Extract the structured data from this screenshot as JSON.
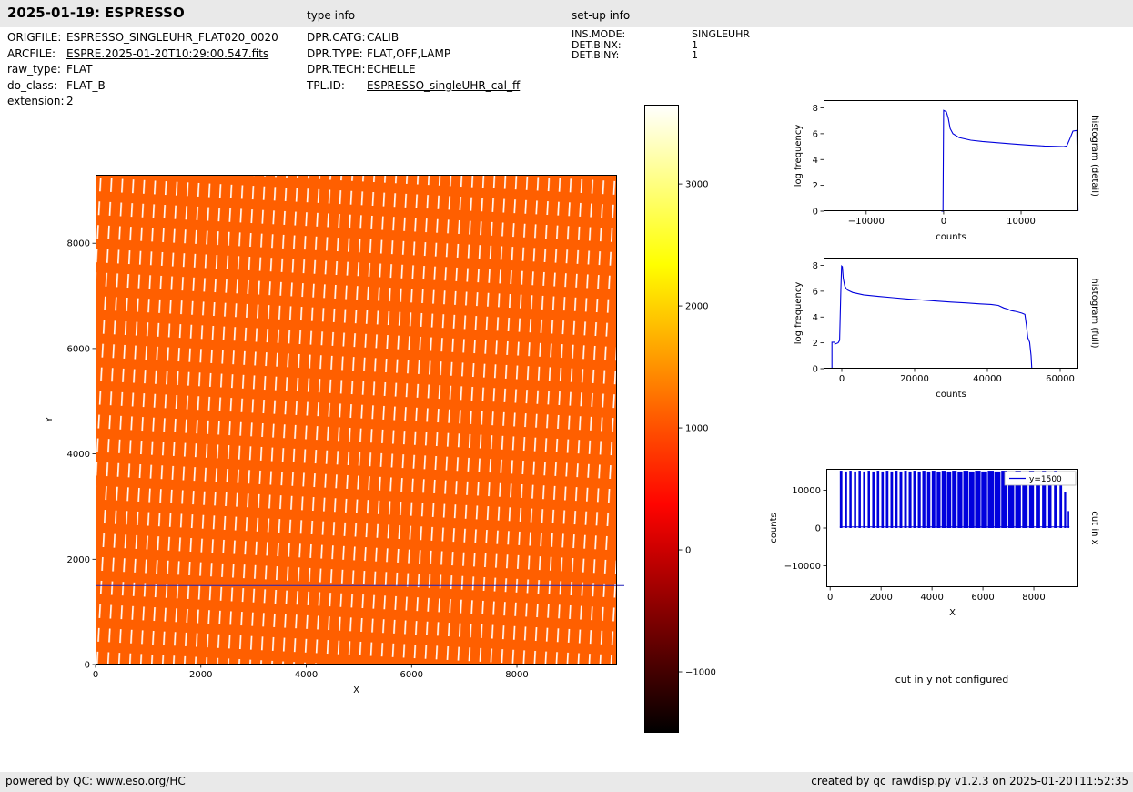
{
  "header": {
    "title": "2025-01-19: ESPRESSO",
    "type_info_label": "type info",
    "setup_info_label": "set-up info"
  },
  "file_info": {
    "rows": [
      {
        "label": "ORIGFILE:",
        "value": "ESPRESSO_SINGLEUHR_FLAT020_0020"
      },
      {
        "label": "ARCFILE:",
        "value": "ESPRE.2025-01-20T10:29:00.547.fits"
      },
      {
        "label": "raw_type:",
        "value": "FLAT"
      },
      {
        "label": "do_class:",
        "value": "FLAT_B"
      },
      {
        "label": "extension:",
        "value": "2"
      }
    ]
  },
  "type_info": {
    "rows": [
      {
        "label": "DPR.CATG:",
        "value": "CALIB"
      },
      {
        "label": "DPR.TYPE:",
        "value": "FLAT,OFF,LAMP"
      },
      {
        "label": "DPR.TECH:",
        "value": "ECHELLE"
      },
      {
        "label": "TPL.ID:",
        "value": "ESPRESSO_singleUHR_cal_ff"
      }
    ]
  },
  "setup_info": {
    "rows": [
      {
        "label": "INS.MODE:",
        "value": "SINGLEUHR"
      },
      {
        "label": "DET.BINX:",
        "value": "1"
      },
      {
        "label": "DET.BINY:",
        "value": "1"
      }
    ]
  },
  "notes": {
    "cut_y": "cut in y not configured"
  },
  "footer": {
    "left": "powered by QC: www.eso.org/HC",
    "right": "created by qc_rawdisp.py v1.2.3 on 2025-01-20T11:52:35"
  },
  "chart_data": {
    "main_image": {
      "type": "heatmap",
      "description": "Raw ESPRESSO echelle flat-field frame: uniform ~1000-count orange background crossed by near-vertical dashed white echelle orders; blue horizontal cut line at y=1500",
      "xlabel": "X",
      "ylabel": "Y",
      "xlim": [
        0,
        9900
      ],
      "ylim": [
        0,
        9300
      ],
      "xticks": [
        [
          0,
          "0"
        ],
        [
          2000,
          "2000"
        ],
        [
          4000,
          "4000"
        ],
        [
          6000,
          "6000"
        ],
        [
          8000,
          "8000"
        ]
      ],
      "yticks": [
        [
          0,
          "0"
        ],
        [
          2000,
          "2000"
        ],
        [
          4000,
          "4000"
        ],
        [
          6000,
          "6000"
        ],
        [
          8000,
          "8000"
        ]
      ],
      "base_color": "#ff5f00",
      "stripe_color": "#ffffff",
      "ylabel_off": 48,
      "hline": {
        "y": 1500,
        "color": "#2222bb",
        "label": "y=1500"
      }
    },
    "colorbar": {
      "type": "colorbar",
      "description": "hot colormap, counts scale",
      "vmin": -1500,
      "vmax": 3650,
      "ticks": [
        [
          3000,
          "3000"
        ],
        [
          2000,
          "2000"
        ],
        [
          1000,
          "1000"
        ],
        [
          0,
          "0"
        ],
        [
          -1000,
          "−1000"
        ]
      ],
      "stops": [
        [
          "0%",
          "#000000"
        ],
        [
          "14.6%",
          "#660000"
        ],
        [
          "29.1%",
          "#cc0000"
        ],
        [
          "36.4%",
          "#ff0400"
        ],
        [
          "48.5%",
          "#ff5000"
        ],
        [
          "58.3%",
          "#ff9200"
        ],
        [
          "68%",
          "#ffd300"
        ],
        [
          "74.6%",
          "#ffff00"
        ],
        [
          "87.4%",
          "#ffff80"
        ],
        [
          "100%",
          "#ffffff"
        ]
      ]
    },
    "hist_detail": {
      "type": "line",
      "xlabel": "counts",
      "ylabel": "log frequency",
      "right_label": "histogram (detail)",
      "xlim": [
        -15500,
        17400
      ],
      "ylim": [
        0,
        8.6
      ],
      "xticks": [
        [
          -10000,
          "−10000"
        ],
        [
          0,
          "0"
        ],
        [
          10000,
          "10000"
        ]
      ],
      "yticks": [
        [
          0,
          "0"
        ],
        [
          2,
          "2"
        ],
        [
          4,
          "4"
        ],
        [
          6,
          "6"
        ],
        [
          8,
          "8"
        ]
      ],
      "ylabel_off": 25,
      "series": [
        {
          "name": "log frequency",
          "color": "#0000dd",
          "points": [
            [
              -300,
              0
            ],
            [
              -80,
              0
            ],
            [
              0,
              7.8
            ],
            [
              350,
              7.7
            ],
            [
              600,
              7.2
            ],
            [
              850,
              6.4
            ],
            [
              1200,
              6.0
            ],
            [
              2000,
              5.7
            ],
            [
              3500,
              5.5
            ],
            [
              5000,
              5.4
            ],
            [
              7000,
              5.3
            ],
            [
              9000,
              5.2
            ],
            [
              11000,
              5.12
            ],
            [
              13000,
              5.05
            ],
            [
              15500,
              5.0
            ],
            [
              15900,
              5.05
            ],
            [
              16300,
              5.6
            ],
            [
              16700,
              6.2
            ],
            [
              17200,
              6.25
            ],
            [
              17350,
              0
            ]
          ]
        }
      ]
    },
    "hist_full": {
      "type": "line",
      "xlabel": "counts",
      "ylabel": "log frequency",
      "right_label": "histogram (full)",
      "xlim": [
        -5000,
        65000
      ],
      "ylim": [
        0,
        8.6
      ],
      "xticks": [
        [
          0,
          "0"
        ],
        [
          20000,
          "20000"
        ],
        [
          40000,
          "40000"
        ],
        [
          60000,
          "60000"
        ]
      ],
      "yticks": [
        [
          0,
          "0"
        ],
        [
          2,
          "2"
        ],
        [
          4,
          "4"
        ],
        [
          6,
          "6"
        ],
        [
          8,
          "8"
        ]
      ],
      "ylabel_off": 25,
      "series": [
        {
          "name": "log frequency",
          "color": "#0000dd",
          "points": [
            [
              -2700,
              0
            ],
            [
              -2700,
              2.05
            ],
            [
              -1900,
              2.05
            ],
            [
              -1900,
              1.9
            ],
            [
              -1000,
              2.0
            ],
            [
              -600,
              2.2
            ],
            [
              -250,
              6.2
            ],
            [
              -50,
              7.95
            ],
            [
              150,
              7.9
            ],
            [
              400,
              7.0
            ],
            [
              800,
              6.4
            ],
            [
              1500,
              6.1
            ],
            [
              3000,
              5.9
            ],
            [
              6000,
              5.72
            ],
            [
              10000,
              5.6
            ],
            [
              14000,
              5.5
            ],
            [
              18000,
              5.4
            ],
            [
              22000,
              5.32
            ],
            [
              26000,
              5.24
            ],
            [
              30000,
              5.16
            ],
            [
              34000,
              5.1
            ],
            [
              38000,
              5.02
            ],
            [
              41000,
              4.98
            ],
            [
              43000,
              4.9
            ],
            [
              44500,
              4.7
            ],
            [
              45500,
              4.62
            ],
            [
              46500,
              4.5
            ],
            [
              47500,
              4.45
            ],
            [
              48500,
              4.38
            ],
            [
              49500,
              4.3
            ],
            [
              50300,
              4.2
            ],
            [
              50700,
              3.4
            ],
            [
              51100,
              2.4
            ],
            [
              51600,
              2.05
            ],
            [
              52000,
              1.0
            ],
            [
              52200,
              0
            ]
          ]
        }
      ]
    },
    "cut_x": {
      "type": "bars",
      "description": "Cut through the raw frame at row y=1500: echelle orders appear as dense vertical spikes up to ~15000 counts",
      "xlabel": "X",
      "ylabel": "counts",
      "right_label": "cut in x",
      "xlim": [
        -150,
        9750
      ],
      "ylim": [
        -15700,
        15700
      ],
      "xticks": [
        [
          0,
          "0"
        ],
        [
          2000,
          "2000"
        ],
        [
          4000,
          "4000"
        ],
        [
          6000,
          "6000"
        ],
        [
          8000,
          "8000"
        ]
      ],
      "yticks": [
        [
          -10000,
          "−10000"
        ],
        [
          0,
          "0"
        ],
        [
          10000,
          "10000"
        ]
      ],
      "ylabel_off": 55,
      "bar_color": "#0000dd",
      "baseline": [
        380,
        9400,
        300
      ],
      "legend": {
        "label": "y=1500",
        "color": "#0000dd"
      },
      "bars": [
        [
          430,
          100,
          15200
        ],
        [
          620,
          90,
          15000
        ],
        [
          800,
          90,
          15200
        ],
        [
          980,
          90,
          15000
        ],
        [
          1160,
          90,
          15200
        ],
        [
          1340,
          90,
          15000
        ],
        [
          1520,
          90,
          15200
        ],
        [
          1700,
          95,
          15000
        ],
        [
          1880,
          95,
          15200
        ],
        [
          2060,
          95,
          15000
        ],
        [
          2240,
          100,
          15200
        ],
        [
          2420,
          100,
          15000
        ],
        [
          2600,
          100,
          15200
        ],
        [
          2780,
          105,
          15000
        ],
        [
          2960,
          105,
          15200
        ],
        [
          3140,
          110,
          15000
        ],
        [
          3320,
          110,
          15200
        ],
        [
          3500,
          115,
          15000
        ],
        [
          3680,
          120,
          15200
        ],
        [
          3870,
          130,
          15000
        ],
        [
          4060,
          140,
          15200
        ],
        [
          4260,
          150,
          15000
        ],
        [
          4460,
          160,
          15200
        ],
        [
          4670,
          170,
          15000
        ],
        [
          4880,
          180,
          15200
        ],
        [
          5100,
          190,
          15000
        ],
        [
          5330,
          200,
          15200
        ],
        [
          5560,
          210,
          15000
        ],
        [
          5800,
          220,
          15200
        ],
        [
          6050,
          230,
          15000
        ],
        [
          6310,
          235,
          15200
        ],
        [
          6570,
          240,
          15000
        ],
        [
          6840,
          240,
          15200
        ],
        [
          7110,
          235,
          15000
        ],
        [
          7380,
          225,
          15200
        ],
        [
          7650,
          210,
          15000
        ],
        [
          7910,
          190,
          15200
        ],
        [
          8160,
          170,
          15000
        ],
        [
          8400,
          150,
          15200
        ],
        [
          8630,
          130,
          15000
        ],
        [
          8850,
          115,
          15200
        ],
        [
          9060,
          100,
          13800
        ],
        [
          9230,
          80,
          9500
        ],
        [
          9360,
          60,
          4500
        ]
      ]
    }
  }
}
